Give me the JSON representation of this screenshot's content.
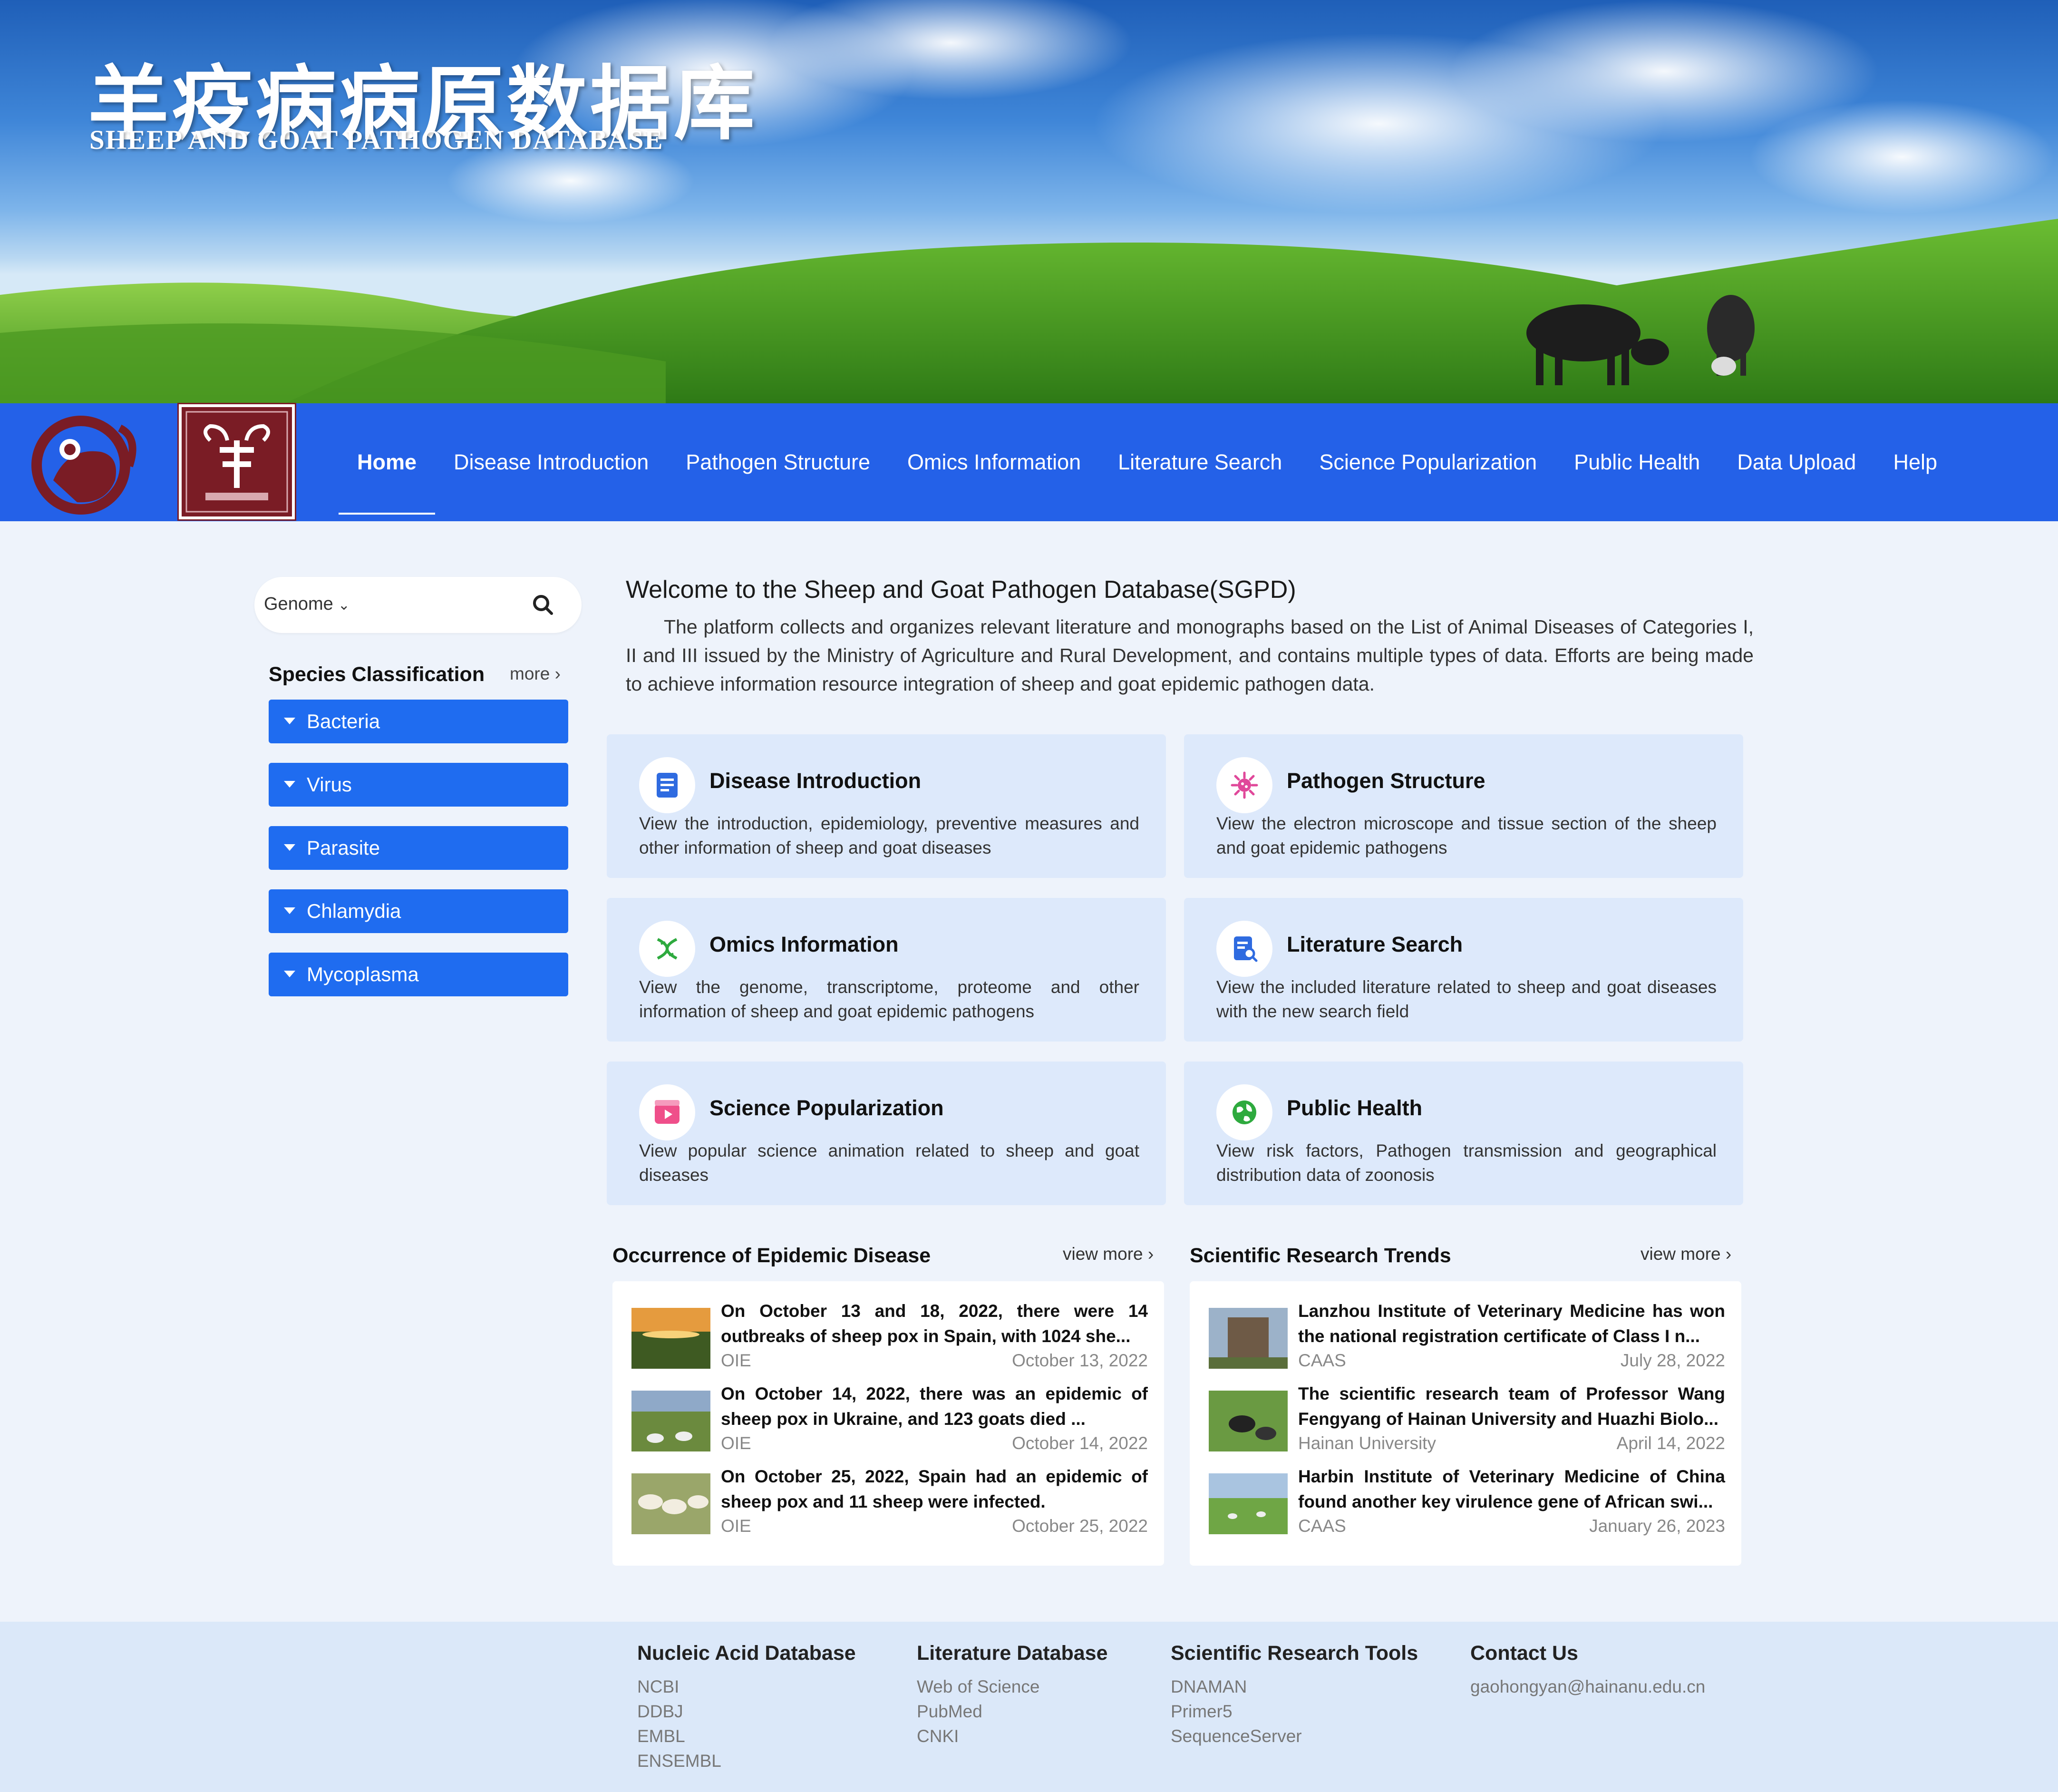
{
  "banner": {
    "title_cn": "羊疫病病原数据库",
    "title_en": "SHEEP AND GOAT PATHOGEN DATABASE"
  },
  "nav": {
    "items": [
      {
        "label": "Home",
        "active": true
      },
      {
        "label": "Disease Introduction"
      },
      {
        "label": "Pathogen Structure"
      },
      {
        "label": "Omics Information"
      },
      {
        "label": "Literature Search"
      },
      {
        "label": "Science Popularization"
      },
      {
        "label": "Public Health"
      },
      {
        "label": "Data Upload"
      },
      {
        "label": "Help"
      }
    ]
  },
  "sidebar": {
    "search_select": "Genome",
    "species_heading": "Species Classification",
    "more": "more",
    "categories": [
      "Bacteria",
      "Virus",
      "Parasite",
      "Chlamydia",
      "Mycoplasma"
    ]
  },
  "welcome": {
    "title": "Welcome to the Sheep and Goat Pathogen Database(SGPD)",
    "text": "The platform collects and organizes relevant literature and monographs based on the List of Animal Diseases of Categories I, II and III issued by the Ministry of Agriculture and Rural Development, and contains multiple types of data. Efforts are being made to achieve information resource integration of sheep and goat epidemic pathogen data."
  },
  "cards": [
    {
      "title": "Disease Introduction",
      "desc": "View the introduction, epidemiology, preventive measures and other information of sheep and goat diseases",
      "icon": "document-icon",
      "color": "#2f6be0"
    },
    {
      "title": "Pathogen Structure",
      "desc": "View the electron microscope and tissue section of the sheep and goat epidemic pathogens",
      "icon": "virus-icon",
      "color": "#e0489a"
    },
    {
      "title": "Omics Information",
      "desc": "View the genome, transcriptome, proteome and other information of sheep and goat epidemic pathogens",
      "icon": "dna-icon",
      "color": "#2eaa3e"
    },
    {
      "title": "Literature Search",
      "desc": "View the included literature related to sheep and goat diseases with the new search field",
      "icon": "literature-search-icon",
      "color": "#2f6be0"
    },
    {
      "title": "Science Popularization",
      "desc": "View popular science animation related to sheep and goat diseases",
      "icon": "video-icon",
      "color": "#ef4f8a"
    },
    {
      "title": "Public Health",
      "desc": "View risk factors, Pathogen transmission and geographical distribution data of zoonosis",
      "icon": "globe-icon",
      "color": "#2eaa3e"
    }
  ],
  "epidemic": {
    "title": "Occurrence of Epidemic Disease",
    "more": "view more",
    "items": [
      {
        "title": "On October 13 and 18, 2022, there were 14 outbreaks of sheep pox in Spain, with 1024 she...",
        "source": "OIE",
        "date": "October 13, 2022"
      },
      {
        "title": "On October 14, 2022, there was an epidemic of sheep pox in Ukraine, and 123 goats died ...",
        "source": "OIE",
        "date": "October 14, 2022"
      },
      {
        "title": "On October 25, 2022, Spain had an epidemic of sheep pox and 11 sheep were infected.",
        "source": "OIE",
        "date": "October 25, 2022"
      }
    ]
  },
  "research": {
    "title": "Scientific Research Trends",
    "more": "view more",
    "items": [
      {
        "title": "Lanzhou Institute of Veterinary Medicine has won the national registration certificate of Class I n...",
        "source": "CAAS",
        "date": "July 28, 2022"
      },
      {
        "title": "The scientific research team of Professor Wang Fengyang of Hainan University and Huazhi Biolo...",
        "source": "Hainan University",
        "date": "April 14, 2022"
      },
      {
        "title": "Harbin Institute of Veterinary Medicine of China found another key virulence gene of African swi...",
        "source": "CAAS",
        "date": "January 26, 2023"
      }
    ]
  },
  "footer": {
    "nucleic": {
      "title": "Nucleic Acid Database",
      "links": [
        "NCBI",
        "DDBJ",
        "EMBL",
        "ENSEMBL"
      ]
    },
    "literature": {
      "title": "Literature Database",
      "links": [
        "Web of Science",
        "PubMed",
        "CNKI"
      ]
    },
    "tools": {
      "title": "Scientific Research Tools",
      "links": [
        "DNAMAN",
        "Primer5",
        "SequenceServer"
      ]
    },
    "contact": {
      "title": "Contact Us",
      "email": "gaohongyan@hainanu.edu.cn"
    }
  }
}
